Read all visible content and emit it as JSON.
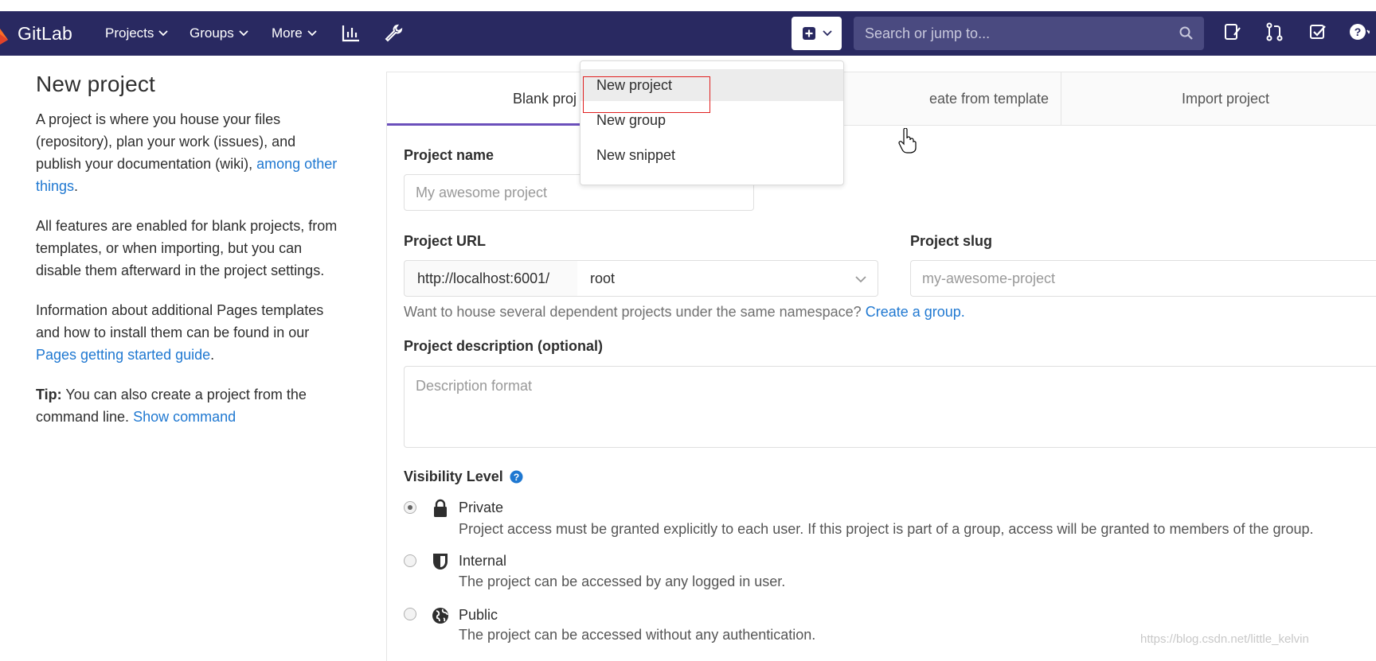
{
  "app": {
    "name": "GitLab",
    "brand_color": "#292961",
    "accent_color": "#1f78d1"
  },
  "navbar": {
    "items": [
      {
        "label": "Projects"
      },
      {
        "label": "Groups"
      },
      {
        "label": "More"
      }
    ],
    "icons": [
      "activity-chart-icon",
      "admin-wrench-icon"
    ],
    "new_button_icon": "plus-square-icon",
    "search": {
      "placeholder": "Search or jump to..."
    },
    "right_icons": [
      "issues-icon",
      "merge-requests-icon",
      "todos-icon",
      "help-icon"
    ]
  },
  "sidebar": {
    "title": "New project",
    "p1": "A project is where you house your files (repository), plan your work (issues), and publish your documentation (wiki), ",
    "p1_link": "among other things",
    "p1_end": ".",
    "p2": "All features are enabled for blank projects, from templates, or when importing, but you can disable them afterward in the project settings.",
    "p3": "Information about additional Pages templates and how to install them can be found in our ",
    "p3_link": "Pages getting started guide",
    "p3_end": ".",
    "tip_label": "Tip:",
    "tip_text": " You can also create a project from the command line. ",
    "tip_link": "Show command"
  },
  "tabs": [
    {
      "label": "Blank proj",
      "active": true
    },
    {
      "label": "eate from template",
      "active": false
    },
    {
      "label": "Import project",
      "active": false
    }
  ],
  "form": {
    "project_name_label": "Project name",
    "project_name_placeholder": "My awesome project",
    "project_url_label": "Project URL",
    "url_prefix": "http://localhost:6001/",
    "namespace_value": "root",
    "project_slug_label": "Project slug",
    "project_slug_placeholder": "my-awesome-project",
    "help_text": "Want to house several dependent projects under the same namespace? ",
    "help_link": "Create a group.",
    "description_label": "Project description (optional)",
    "description_placeholder": "Description format"
  },
  "visibility": {
    "title": "Visibility Level",
    "options": [
      {
        "name": "Private",
        "icon": "lock-icon",
        "checked": true,
        "desc": "Project access must be granted explicitly to each user. If this project is part of a group, access will be granted to members of the group."
      },
      {
        "name": "Internal",
        "icon": "shield-icon",
        "checked": false,
        "desc": "The project can be accessed by any logged in user."
      },
      {
        "name": "Public",
        "icon": "globe-icon",
        "checked": false,
        "desc": "The project can be accessed without any authentication."
      }
    ]
  },
  "dropdown": {
    "items": [
      {
        "label": "New project",
        "hover": true
      },
      {
        "label": "New group",
        "hover": false
      },
      {
        "label": "New snippet",
        "hover": false
      }
    ],
    "highlight_color": "#e02020"
  },
  "watermark": "https://blog.csdn.net/little_kelvin"
}
